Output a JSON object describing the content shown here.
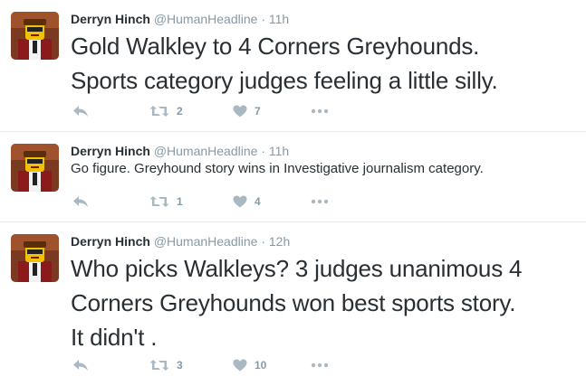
{
  "tweets": [
    {
      "fullname": "Derryn Hinch",
      "screenname": "@HumanHeadline",
      "dot": "·",
      "time": "11h",
      "line1": "Gold Walkley to 4 Corners Greyhounds.",
      "line2": "Sports category judges feeling a little silly.",
      "line3": "",
      "retweets": "2",
      "likes": "7"
    },
    {
      "fullname": "Derryn Hinch",
      "screenname": "@HumanHeadline",
      "dot": "·",
      "time": "11h",
      "line1": "Go figure. Greyhound story wins in Investigative journalism category.",
      "line2": "",
      "line3": "",
      "retweets": "1",
      "likes": "4"
    },
    {
      "fullname": "Derryn Hinch",
      "screenname": "@HumanHeadline",
      "dot": "·",
      "time": "12h",
      "line1": "Who picks Walkleys? 3 judges unanimous 4",
      "line2": "Corners Greyhounds won best sports story.",
      "line3": "It didn't .",
      "retweets": "3",
      "likes": "10"
    }
  ],
  "icons": {
    "reply": "reply-icon",
    "retweet": "retweet-icon",
    "like": "heart-icon",
    "more": "more-icon"
  },
  "colors": {
    "icon": "#aab8c2",
    "meta": "#8899a6",
    "text": "#292f33",
    "divider": "#e6ecf0"
  }
}
